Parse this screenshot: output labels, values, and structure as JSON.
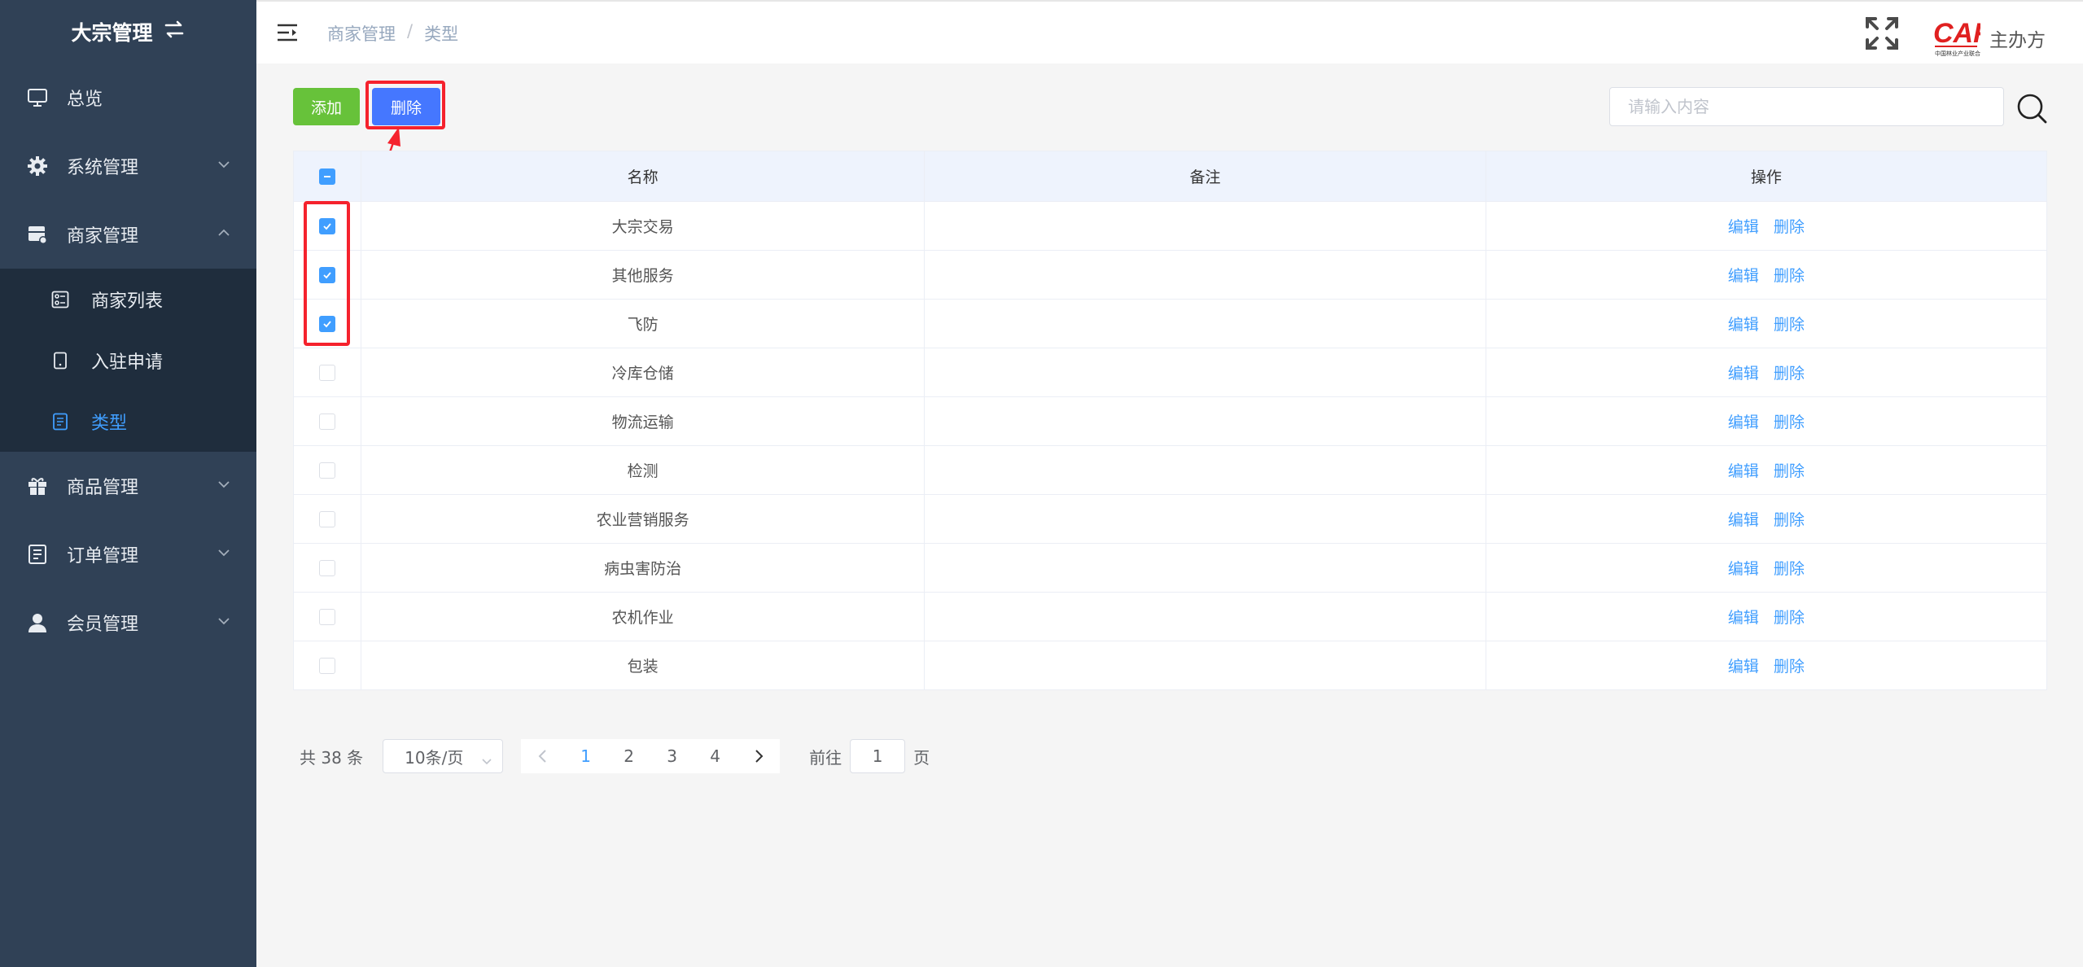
{
  "sidebar": {
    "title": "大宗管理",
    "items": [
      {
        "label": "总览"
      },
      {
        "label": "系统管理"
      },
      {
        "label": "商家管理"
      },
      {
        "label": "商品管理"
      },
      {
        "label": "订单管理"
      },
      {
        "label": "会员管理"
      }
    ],
    "subitems": [
      {
        "label": "商家列表"
      },
      {
        "label": "入驻申请"
      },
      {
        "label": "类型"
      }
    ]
  },
  "header": {
    "breadcrumb": [
      "商家管理",
      "类型"
    ],
    "breadcrumb_sep": "/",
    "logo_text": "主办方",
    "logo_mark": "CAF",
    "logo_caption": "中国林业产业联合会"
  },
  "toolbar": {
    "add_label": "添加",
    "delete_label": "删除",
    "search_placeholder": "请输入内容"
  },
  "table": {
    "columns": [
      "名称",
      "备注",
      "操作"
    ],
    "edit_label": "编辑",
    "delete_label": "删除",
    "rows": [
      {
        "name": "大宗交易",
        "remark": "",
        "checked": true
      },
      {
        "name": "其他服务",
        "remark": "",
        "checked": true
      },
      {
        "name": "飞防",
        "remark": "",
        "checked": true
      },
      {
        "name": "冷库仓储",
        "remark": "",
        "checked": false
      },
      {
        "name": "物流运输",
        "remark": "",
        "checked": false
      },
      {
        "name": "检测",
        "remark": "",
        "checked": false
      },
      {
        "name": "农业营销服务",
        "remark": "",
        "checked": false
      },
      {
        "name": "病虫害防治",
        "remark": "",
        "checked": false
      },
      {
        "name": "农机作业",
        "remark": "",
        "checked": false
      },
      {
        "name": "包装",
        "remark": "",
        "checked": false
      }
    ]
  },
  "pagination": {
    "total_text": "共 38 条",
    "page_size": "10条/页",
    "pages": [
      "1",
      "2",
      "3",
      "4"
    ],
    "current": "1",
    "goto_prefix": "前往",
    "goto_value": "1",
    "goto_suffix": "页"
  },
  "colors": {
    "sidebar_bg": "#304156",
    "accent": "#409eff",
    "add_button": "#67c23a",
    "delete_button": "#4577ff",
    "highlight": "#f5222d"
  }
}
